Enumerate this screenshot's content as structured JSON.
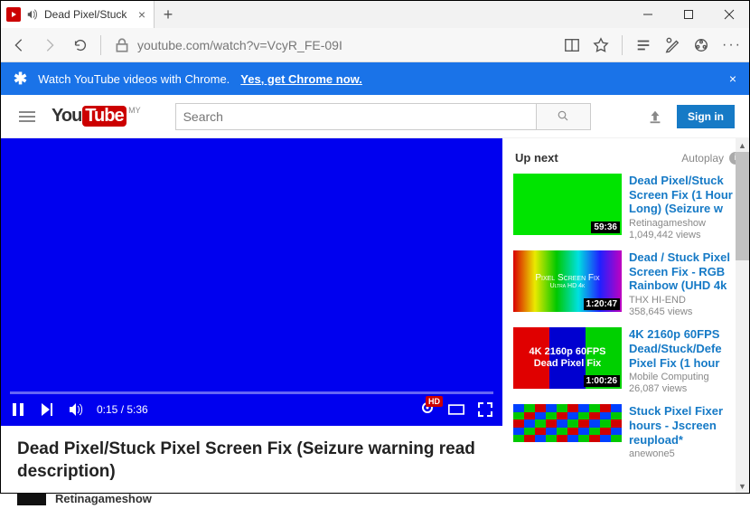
{
  "tab": {
    "title": "Dead Pixel/Stuck Pi"
  },
  "url": "youtube.com/watch?v=VcyR_FE-09I",
  "promo": {
    "text": "Watch YouTube videos with Chrome.",
    "cta": "Yes, get Chrome now.",
    "close": "×"
  },
  "logo": {
    "you": "You",
    "tube": "Tube",
    "region": "MY"
  },
  "search": {
    "placeholder": "Search"
  },
  "signin": "Sign in",
  "player": {
    "elapsed": "0:15",
    "total": "5:36",
    "hd": "HD"
  },
  "video": {
    "title": "Dead Pixel/Stuck Pixel Screen Fix (Seizure warning read description)",
    "channel": "Retinagameshow"
  },
  "sidebar": {
    "header": "Up next",
    "autoplay": "Autoplay",
    "recs": [
      {
        "title": "Dead Pixel/Stuck Screen Fix (1 Hour Long) (Seizure w",
        "channel": "Retinagameshow",
        "views": "1,049,442 views",
        "dur": "59:36"
      },
      {
        "title": "Dead / Stuck Pixel Screen Fix - RGB Rainbow (UHD 4k",
        "channel": "THX HI-END",
        "views": "358,645 views",
        "dur": "1:20:47",
        "thumb_line1": "Pixel Screen Fix",
        "thumb_line2": "Ultra HD 4k"
      },
      {
        "title": "4K 2160p 60FPS Dead/Stuck/Defe Pixel Fix (1 hour",
        "channel": "Mobile Computing",
        "views": "26,087 views",
        "dur": "1:00:26",
        "thumb_line1": "4K 2160p 60FPS",
        "thumb_line2": "Dead Pixel Fix"
      },
      {
        "title": "Stuck Pixel Fixer hours - Jscreen reupload*",
        "channel": "anewone5",
        "views": "",
        "dur": ""
      }
    ]
  }
}
